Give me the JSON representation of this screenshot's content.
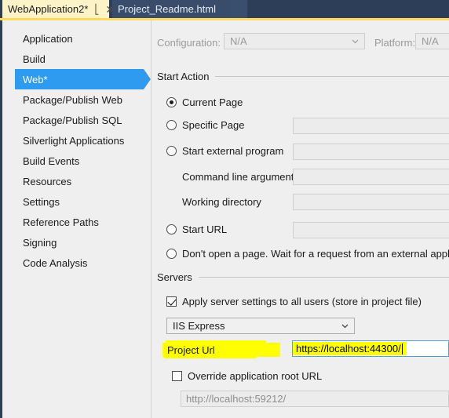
{
  "window": {
    "tabs": [
      {
        "title": "WebApplication2*",
        "active": true,
        "pin_icon": "pin-icon",
        "close_icon": "close-icon"
      },
      {
        "title": "Project_Readme.html",
        "active": false
      }
    ]
  },
  "sidebar": {
    "items": [
      {
        "label": "Application",
        "selected": false
      },
      {
        "label": "Build",
        "selected": false
      },
      {
        "label": "Web*",
        "selected": true
      },
      {
        "label": "Package/Publish Web",
        "selected": false
      },
      {
        "label": "Package/Publish SQL",
        "selected": false
      },
      {
        "label": "Silverlight Applications",
        "selected": false
      },
      {
        "label": "Build Events",
        "selected": false
      },
      {
        "label": "Resources",
        "selected": false
      },
      {
        "label": "Settings",
        "selected": false
      },
      {
        "label": "Reference Paths",
        "selected": false
      },
      {
        "label": "Signing",
        "selected": false
      },
      {
        "label": "Code Analysis",
        "selected": false
      }
    ],
    "selection_color": "#2f9bf0"
  },
  "toolbar": {
    "configuration_label": "Configuration:",
    "configuration_value": "N/A",
    "platform_label": "Platform:",
    "platform_value": "N/A"
  },
  "start_action": {
    "group_title": "Start Action",
    "current_page_label": "Current Page",
    "specific_page_label": "Specific Page",
    "specific_page_value": "",
    "start_external_program_label": "Start external program",
    "start_external_program_value": "",
    "command_line_arguments_label": "Command line arguments",
    "command_line_arguments_value": "",
    "working_directory_label": "Working directory",
    "working_directory_value": "",
    "start_url_label": "Start URL",
    "start_url_value": "",
    "dont_open_label": "Don't open a page.  Wait for a request from an external application"
  },
  "servers": {
    "group_title": "Servers",
    "apply_all_users_label": "Apply server settings to all users (store in project file)",
    "apply_all_users_checked": true,
    "server_combo_value": "IIS Express",
    "project_url_label": "Project Url",
    "project_url_value": "https://localhost:44300/",
    "override_root_label": "Override application root URL",
    "override_root_checked": false,
    "override_root_value": "http://localhost:59212/",
    "highlight_color": "#ffff00"
  }
}
